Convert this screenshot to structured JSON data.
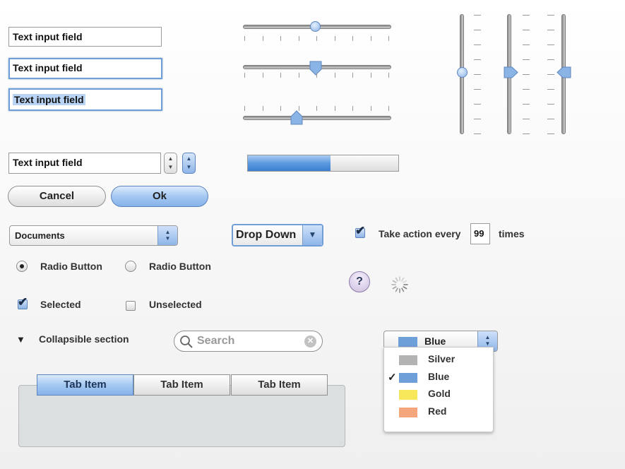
{
  "text_fields": [
    {
      "value": "Text input field"
    },
    {
      "value": "Text input field"
    },
    {
      "value": "Text input field"
    },
    {
      "value": "Text input field"
    }
  ],
  "progress": {
    "fraction": 0.55,
    "color": "#5c9ae0"
  },
  "buttons": {
    "cancel": "Cancel",
    "ok": "Ok"
  },
  "documents_popup": {
    "selected": "Documents",
    "arrows": "▲▼"
  },
  "dropdown": {
    "label": "Drop Down",
    "arrow": "▼"
  },
  "take_action": {
    "prefix": "Take action every",
    "value": "99",
    "suffix": "times",
    "checked": true,
    "check_glyph": "✔"
  },
  "radios": [
    {
      "label": "Radio Button",
      "selected": true
    },
    {
      "label": "Radio Button",
      "selected": false
    }
  ],
  "checkboxes": [
    {
      "label": "Selected",
      "checked": true
    },
    {
      "label": "Unselected",
      "checked": false
    }
  ],
  "help": {
    "glyph": "?"
  },
  "collapsible": {
    "label": "Collapsible section",
    "glyph": "▼"
  },
  "search": {
    "placeholder": "Search",
    "icon": "magnifier-icon",
    "clear_icon": "clear-icon",
    "clear_glyph": "✕"
  },
  "color_popup": {
    "selected": "Blue",
    "options": [
      {
        "label": "Silver",
        "color": "#b3b3b3",
        "checked": false
      },
      {
        "label": "Blue",
        "color": "#6f9fd8",
        "checked": true
      },
      {
        "label": "Gold",
        "color": "#f6e85a",
        "checked": false
      },
      {
        "label": "Red",
        "color": "#f4a67d",
        "checked": false
      }
    ],
    "check_glyph": "✓"
  },
  "tabs": [
    {
      "label": "Tab Item",
      "selected": true
    },
    {
      "label": "Tab Item",
      "selected": false
    },
    {
      "label": "Tab Item",
      "selected": false
    }
  ],
  "colors": {
    "accent": "#6f9ed8",
    "knob": "#8bb4e6"
  }
}
